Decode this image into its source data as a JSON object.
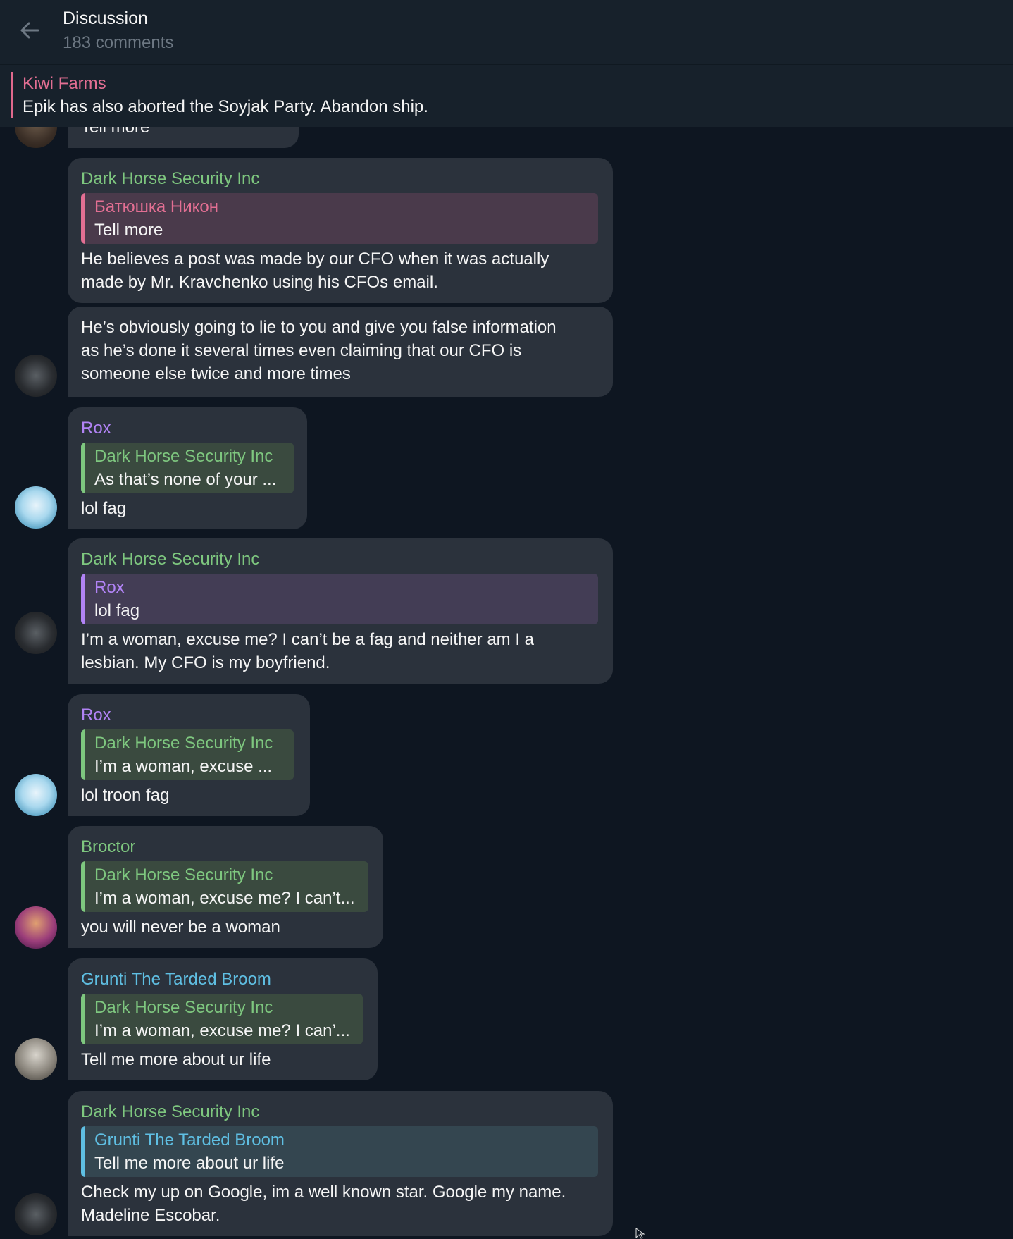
{
  "header": {
    "title": "Discussion",
    "subtitle": "183 comments",
    "back_icon": "arrow-left-icon"
  },
  "pinned": {
    "name": "Kiwi Farms",
    "text": "Epik has also aborted the Soyjak Party. Abandon ship."
  },
  "partial_top": {
    "text": "Tell more"
  },
  "messages": [
    {
      "sender": "Dark Horse Security Inc",
      "quote": {
        "name": "Батюшка Никон",
        "text": "Tell more"
      },
      "text": "He believes a post was made by our CFO when it was actually\nmade by Mr. Kravchenko using his CFOs email."
    },
    {
      "text": "He’s obviously going to lie to you and give you false information\nas he’s done it several times even claiming that our CFO is\nsomeone else twice and more times"
    },
    {
      "sender": "Rox",
      "quote": {
        "name": "Dark Horse Security Inc",
        "text": "As that’s none of your ..."
      },
      "text": "lol fag"
    },
    {
      "sender": "Dark Horse Security Inc",
      "quote": {
        "name": "Rox",
        "text": "lol fag"
      },
      "text": "I’m a woman, excuse me? I can’t be a fag and neither am I a\nlesbian. My CFO is my boyfriend."
    },
    {
      "sender": "Rox",
      "quote": {
        "name": "Dark Horse Security Inc",
        "text": "I’m a woman, excuse ..."
      },
      "text": "lol troon fag"
    },
    {
      "sender": "Broctor",
      "quote": {
        "name": "Dark Horse Security Inc",
        "text": "I’m a woman, excuse me? I can’t..."
      },
      "text": "you will never be a woman"
    },
    {
      "sender": "Grunti The Tarded Broom",
      "quote": {
        "name": "Dark Horse Security Inc",
        "text": "I’m a woman, excuse me? I can’..."
      },
      "text": "Tell me more about ur life"
    },
    {
      "sender": "Dark Horse Security Inc",
      "quote": {
        "name": "Grunti The Tarded Broom",
        "text": "Tell me more about ur life"
      },
      "text": "Check my up on Google, im a well known star. Google my name.\nMadeline Escobar."
    }
  ],
  "colors": {
    "background": "#0e1621",
    "bubble": "#2b323c",
    "header": "#17212b",
    "green_name": "#7ec77f",
    "purple_name": "#b183f5",
    "blue_name": "#5fbfe3",
    "pink_name": "#e36f93"
  },
  "icons": [
    "arrow-left-icon",
    "cursor-icon"
  ]
}
